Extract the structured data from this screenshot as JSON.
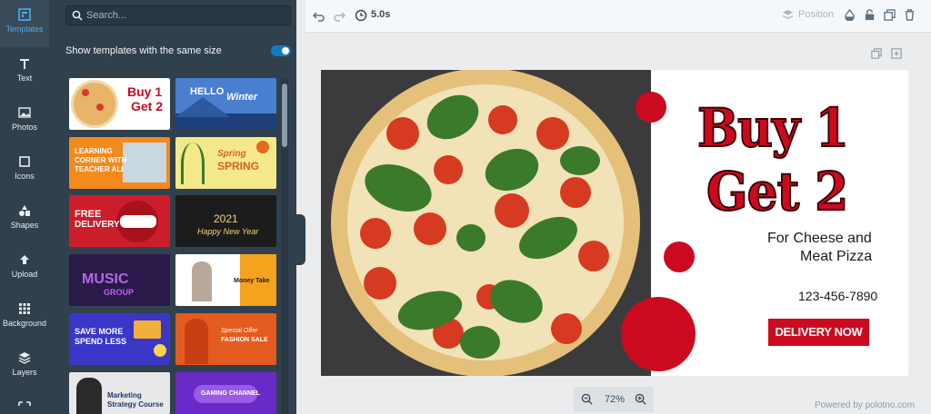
{
  "rail": [
    {
      "label": "Templates",
      "icon": "templates-icon",
      "active": true
    },
    {
      "label": "Text",
      "icon": "text-icon"
    },
    {
      "label": "Photos",
      "icon": "photos-icon"
    },
    {
      "label": "Icons",
      "icon": "icons-icon"
    },
    {
      "label": "Shapes",
      "icon": "shapes-icon"
    },
    {
      "label": "Upload",
      "icon": "upload-icon"
    },
    {
      "label": "Background",
      "icon": "background-icon"
    },
    {
      "label": "Layers",
      "icon": "layers-icon"
    }
  ],
  "panel": {
    "search_placeholder": "Search...",
    "same_size_label": "Show templates with the same size",
    "same_size_on": true,
    "thumbs": [
      {
        "t1": "Buy 1",
        "t2": "Get 2"
      },
      {
        "t1": "HELLO",
        "t2": "Winter"
      },
      {
        "t1": "LEARNING",
        "t2": "CORNER WITH",
        "t3": "TEACHER ALI"
      },
      {
        "t1": "Spring",
        "t2": "SPRING"
      },
      {
        "t1": "FREE",
        "t2": "DELIVERY"
      },
      {
        "t1": "2021",
        "t2": "Happy New Year"
      },
      {
        "t1": "MUSIC",
        "t2": "GROUP"
      },
      {
        "t1": "Money Take"
      },
      {
        "t1": "SAVE MORE",
        "t2": "SPEND LESS"
      },
      {
        "t1": "Special Offer",
        "t2": "FASHION SALE"
      },
      {
        "t1": "Marketing",
        "t2": "Strategy Course"
      },
      {
        "t1": "GAMING CHANNEL"
      }
    ]
  },
  "toolbar": {
    "duration": "5.0s",
    "position": "Position"
  },
  "design": {
    "headline1": "Buy 1",
    "headline2": "Get 2",
    "subline1": "For Cheese and",
    "subline2": "Meat Pizza",
    "phone": "123-456-7890",
    "cta": "DELIVERY NOW",
    "accent": "#cc0a1e"
  },
  "zoom": "72%",
  "powered": "Powered by polotno.com"
}
